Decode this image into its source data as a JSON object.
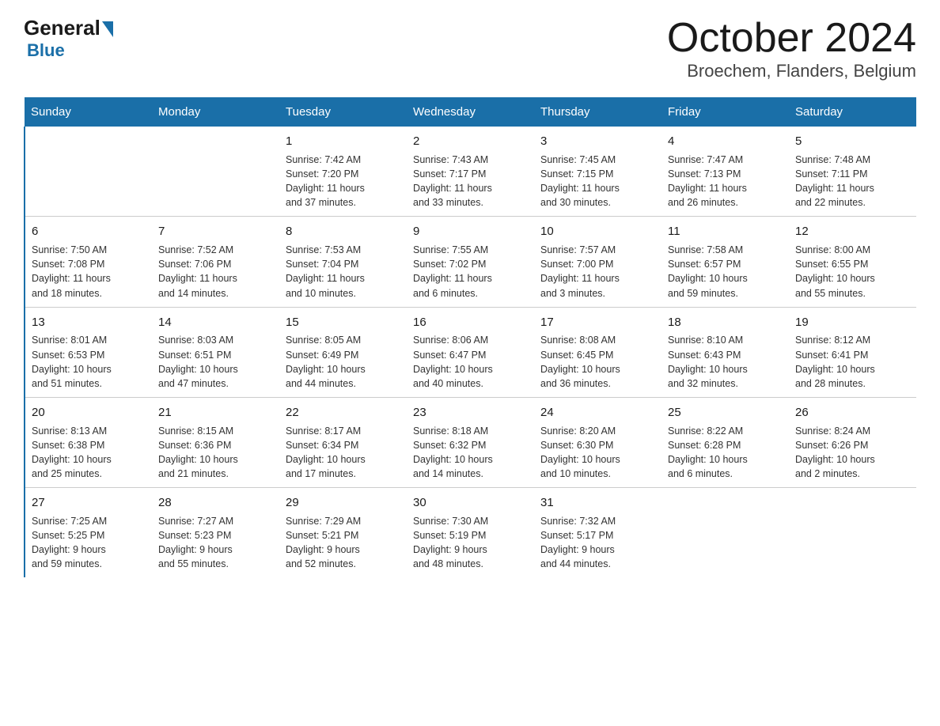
{
  "header": {
    "logo_general": "General",
    "logo_blue": "Blue",
    "title": "October 2024",
    "subtitle": "Broechem, Flanders, Belgium"
  },
  "days_of_week": [
    "Sunday",
    "Monday",
    "Tuesday",
    "Wednesday",
    "Thursday",
    "Friday",
    "Saturday"
  ],
  "weeks": [
    [
      {
        "num": "",
        "info": ""
      },
      {
        "num": "",
        "info": ""
      },
      {
        "num": "1",
        "info": "Sunrise: 7:42 AM\nSunset: 7:20 PM\nDaylight: 11 hours\nand 37 minutes."
      },
      {
        "num": "2",
        "info": "Sunrise: 7:43 AM\nSunset: 7:17 PM\nDaylight: 11 hours\nand 33 minutes."
      },
      {
        "num": "3",
        "info": "Sunrise: 7:45 AM\nSunset: 7:15 PM\nDaylight: 11 hours\nand 30 minutes."
      },
      {
        "num": "4",
        "info": "Sunrise: 7:47 AM\nSunset: 7:13 PM\nDaylight: 11 hours\nand 26 minutes."
      },
      {
        "num": "5",
        "info": "Sunrise: 7:48 AM\nSunset: 7:11 PM\nDaylight: 11 hours\nand 22 minutes."
      }
    ],
    [
      {
        "num": "6",
        "info": "Sunrise: 7:50 AM\nSunset: 7:08 PM\nDaylight: 11 hours\nand 18 minutes."
      },
      {
        "num": "7",
        "info": "Sunrise: 7:52 AM\nSunset: 7:06 PM\nDaylight: 11 hours\nand 14 minutes."
      },
      {
        "num": "8",
        "info": "Sunrise: 7:53 AM\nSunset: 7:04 PM\nDaylight: 11 hours\nand 10 minutes."
      },
      {
        "num": "9",
        "info": "Sunrise: 7:55 AM\nSunset: 7:02 PM\nDaylight: 11 hours\nand 6 minutes."
      },
      {
        "num": "10",
        "info": "Sunrise: 7:57 AM\nSunset: 7:00 PM\nDaylight: 11 hours\nand 3 minutes."
      },
      {
        "num": "11",
        "info": "Sunrise: 7:58 AM\nSunset: 6:57 PM\nDaylight: 10 hours\nand 59 minutes."
      },
      {
        "num": "12",
        "info": "Sunrise: 8:00 AM\nSunset: 6:55 PM\nDaylight: 10 hours\nand 55 minutes."
      }
    ],
    [
      {
        "num": "13",
        "info": "Sunrise: 8:01 AM\nSunset: 6:53 PM\nDaylight: 10 hours\nand 51 minutes."
      },
      {
        "num": "14",
        "info": "Sunrise: 8:03 AM\nSunset: 6:51 PM\nDaylight: 10 hours\nand 47 minutes."
      },
      {
        "num": "15",
        "info": "Sunrise: 8:05 AM\nSunset: 6:49 PM\nDaylight: 10 hours\nand 44 minutes."
      },
      {
        "num": "16",
        "info": "Sunrise: 8:06 AM\nSunset: 6:47 PM\nDaylight: 10 hours\nand 40 minutes."
      },
      {
        "num": "17",
        "info": "Sunrise: 8:08 AM\nSunset: 6:45 PM\nDaylight: 10 hours\nand 36 minutes."
      },
      {
        "num": "18",
        "info": "Sunrise: 8:10 AM\nSunset: 6:43 PM\nDaylight: 10 hours\nand 32 minutes."
      },
      {
        "num": "19",
        "info": "Sunrise: 8:12 AM\nSunset: 6:41 PM\nDaylight: 10 hours\nand 28 minutes."
      }
    ],
    [
      {
        "num": "20",
        "info": "Sunrise: 8:13 AM\nSunset: 6:38 PM\nDaylight: 10 hours\nand 25 minutes."
      },
      {
        "num": "21",
        "info": "Sunrise: 8:15 AM\nSunset: 6:36 PM\nDaylight: 10 hours\nand 21 minutes."
      },
      {
        "num": "22",
        "info": "Sunrise: 8:17 AM\nSunset: 6:34 PM\nDaylight: 10 hours\nand 17 minutes."
      },
      {
        "num": "23",
        "info": "Sunrise: 8:18 AM\nSunset: 6:32 PM\nDaylight: 10 hours\nand 14 minutes."
      },
      {
        "num": "24",
        "info": "Sunrise: 8:20 AM\nSunset: 6:30 PM\nDaylight: 10 hours\nand 10 minutes."
      },
      {
        "num": "25",
        "info": "Sunrise: 8:22 AM\nSunset: 6:28 PM\nDaylight: 10 hours\nand 6 minutes."
      },
      {
        "num": "26",
        "info": "Sunrise: 8:24 AM\nSunset: 6:26 PM\nDaylight: 10 hours\nand 2 minutes."
      }
    ],
    [
      {
        "num": "27",
        "info": "Sunrise: 7:25 AM\nSunset: 5:25 PM\nDaylight: 9 hours\nand 59 minutes."
      },
      {
        "num": "28",
        "info": "Sunrise: 7:27 AM\nSunset: 5:23 PM\nDaylight: 9 hours\nand 55 minutes."
      },
      {
        "num": "29",
        "info": "Sunrise: 7:29 AM\nSunset: 5:21 PM\nDaylight: 9 hours\nand 52 minutes."
      },
      {
        "num": "30",
        "info": "Sunrise: 7:30 AM\nSunset: 5:19 PM\nDaylight: 9 hours\nand 48 minutes."
      },
      {
        "num": "31",
        "info": "Sunrise: 7:32 AM\nSunset: 5:17 PM\nDaylight: 9 hours\nand 44 minutes."
      },
      {
        "num": "",
        "info": ""
      },
      {
        "num": "",
        "info": ""
      }
    ]
  ]
}
